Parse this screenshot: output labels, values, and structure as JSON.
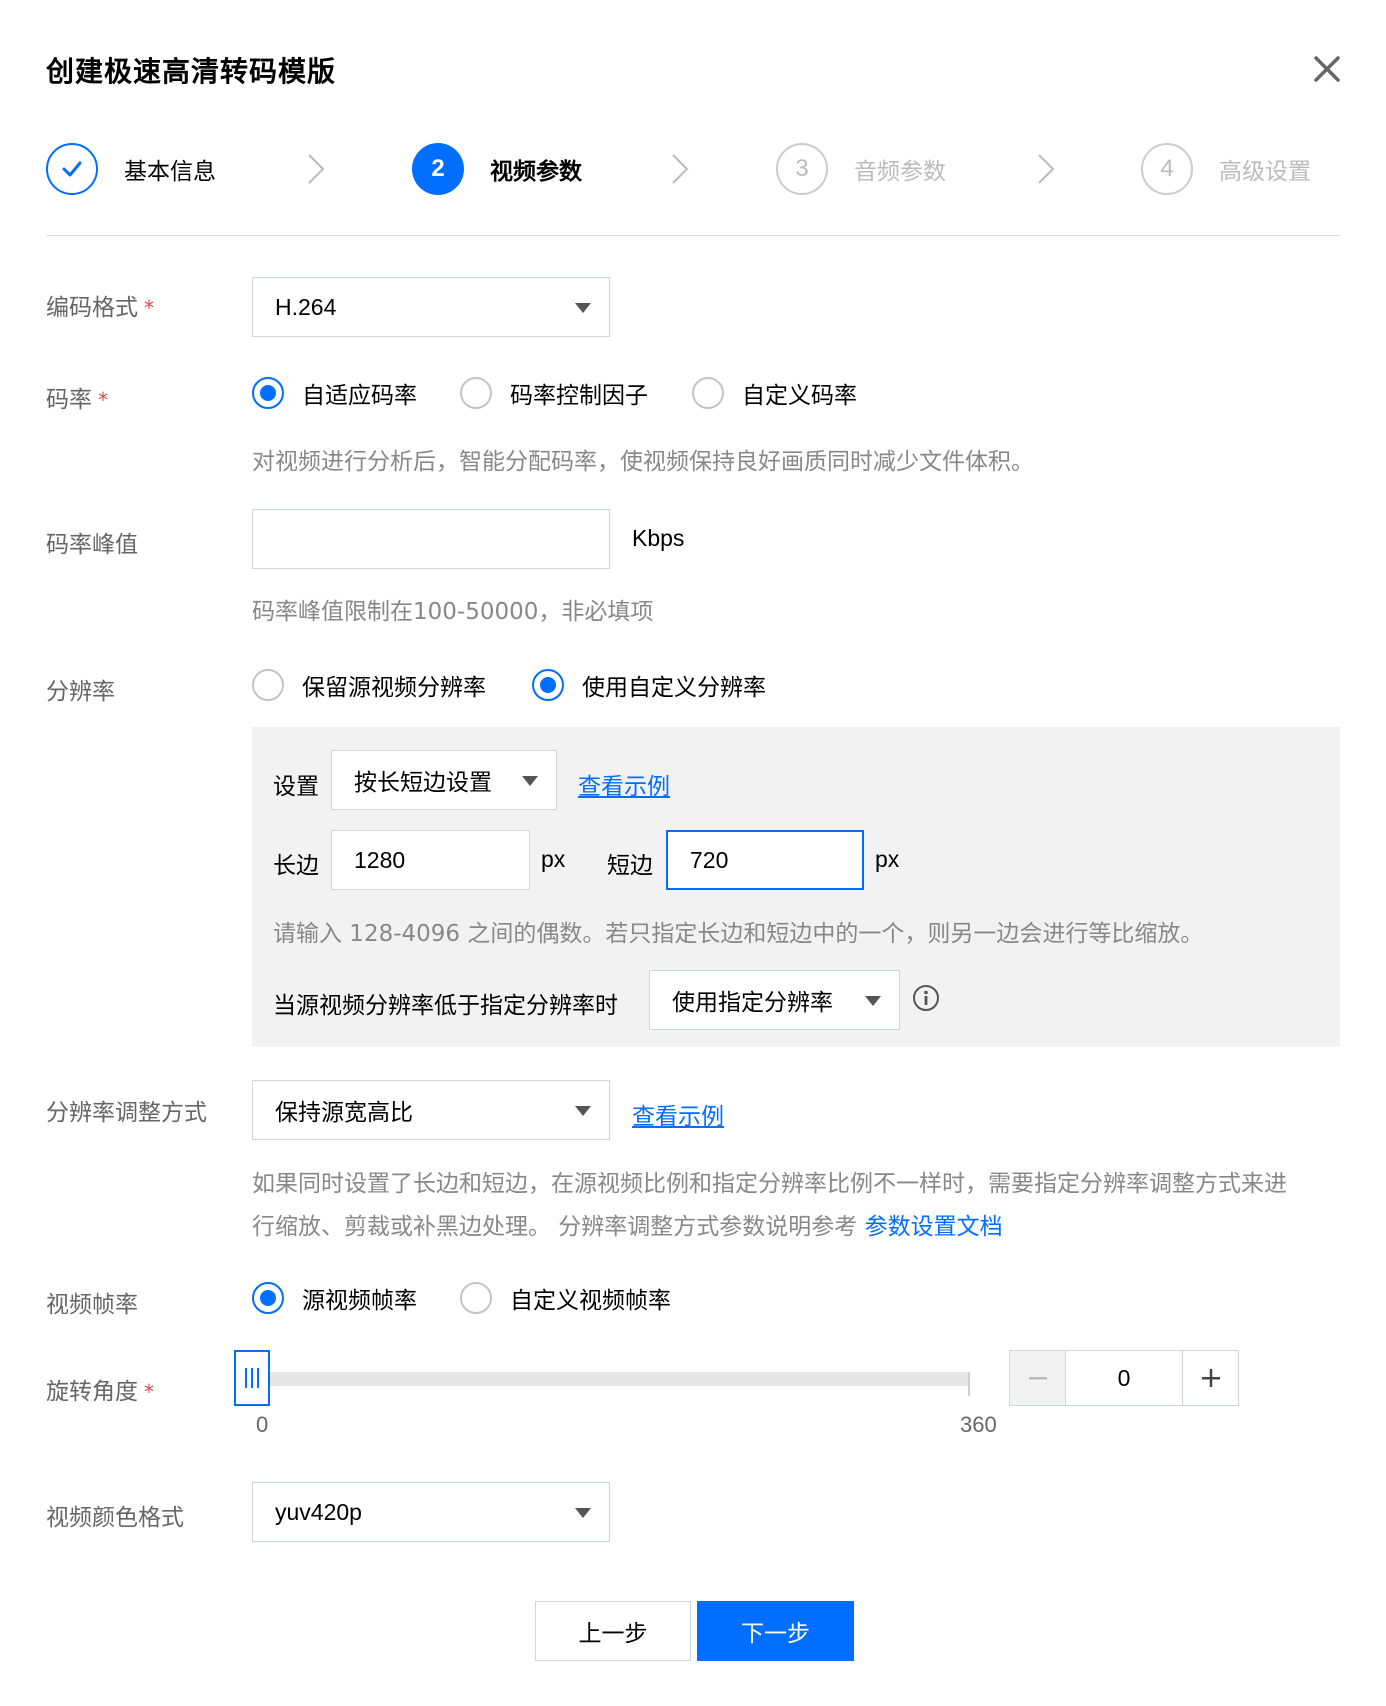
{
  "dialog": {
    "title": "创建极速高清转码模版"
  },
  "steps": [
    {
      "num": "",
      "label": "基本信息",
      "state": "done"
    },
    {
      "num": "2",
      "label": "视频参数",
      "state": "active"
    },
    {
      "num": "3",
      "label": "音频参数",
      "state": "todo"
    },
    {
      "num": "4",
      "label": "高级设置",
      "state": "todo"
    }
  ],
  "form": {
    "codec": {
      "label": "编码格式",
      "required_mark": "*",
      "value": "H.264"
    },
    "bitrate": {
      "label": "码率",
      "required_mark": "*",
      "options": [
        "自适应码率",
        "码率控制因子",
        "自定义码率"
      ],
      "selected": "自适应码率",
      "hint": "对视频进行分析后，智能分配码率，使视频保持良好画质同时减少文件体积。"
    },
    "peak": {
      "label": "码率峰值",
      "value": "",
      "unit": "Kbps",
      "hint": "码率峰值限制在100-50000，非必填项"
    },
    "resolution": {
      "label": "分辨率",
      "options": [
        "保留源视频分辨率",
        "使用自定义分辨率"
      ],
      "selected": "使用自定义分辨率",
      "setting_label": "设置",
      "setting_value": "按长短边设置",
      "example_link": "查看示例",
      "long_label": "长边",
      "long_value": "1280",
      "short_label": "短边",
      "short_value": "720",
      "px_unit": "px",
      "hint": "请输入 128-4096 之间的偶数。若只指定长边和短边中的一个，则另一边会进行等比缩放。",
      "lower_label": "当源视频分辨率低于指定分辨率时",
      "lower_value": "使用指定分辨率"
    },
    "adjust": {
      "label": "分辨率调整方式",
      "value": "保持源宽高比",
      "example_link": "查看示例",
      "hint_line1": "如果同时设置了长边和短边，在源视频比例和指定分辨率比例不一样时，需要指定分辨率调整方式来进",
      "hint_line2": "行缩放、剪裁或补黑边处理。 分辨率调整方式参数说明参考",
      "doc_link": "参数设置文档"
    },
    "fps": {
      "label": "视频帧率",
      "options": [
        "源视频帧率",
        "自定义视频帧率"
      ],
      "selected": "源视频帧率"
    },
    "rotation": {
      "label": "旋转角度",
      "required_mark": "*",
      "min": "0",
      "max": "360",
      "value": "0",
      "fraction": 0
    },
    "color": {
      "label": "视频颜色格式",
      "value": "yuv420p"
    }
  },
  "footer": {
    "prev_label": "上一步",
    "next_label": "下一步"
  },
  "colors": {
    "accent": "#006eff",
    "required": "#e54545",
    "panel_bg": "#f2f2f2"
  },
  "icons": [
    "close-icon",
    "check-icon",
    "chevron-right-icon",
    "caret-down-icon",
    "info-icon",
    "minus-icon",
    "plus-icon"
  ]
}
